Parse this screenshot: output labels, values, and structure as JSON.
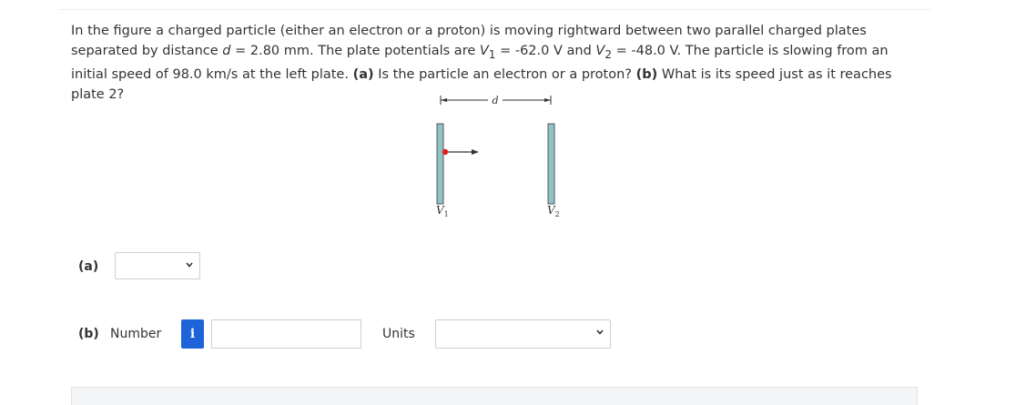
{
  "question": {
    "s1": "In the figure a charged particle (either an electron or a proton) is moving rightward between two parallel charged plates separated by distance ",
    "d_var": "d",
    "s2": " = 2.80 mm. The plate potentials are ",
    "v1_var": "V",
    "v1_sub": "1",
    "s3": " = -62.0 V and ",
    "v2_var": "V",
    "v2_sub": "2",
    "s4": " = -48.0 V. The particle is slowing from an initial speed of 98.0 km/s at the left plate. ",
    "part_a_label": "(a)",
    "part_a_text": " Is the particle an electron or a proton? ",
    "part_b_label": "(b)",
    "part_b_text": " What is its speed just as it reaches plate 2?"
  },
  "figure": {
    "d_label": "d",
    "plate1_var": "V",
    "plate1_sub": "1",
    "plate2_var": "V",
    "plate2_sub": "2",
    "plate_color": "#8fc3c4",
    "particle_color": "#e02020"
  },
  "answer_a": {
    "label": "(a)",
    "selected": ""
  },
  "answer_b": {
    "label": "(b)",
    "number_label": "Number",
    "info_glyph": "i",
    "number_value": "",
    "units_label": "Units",
    "units_selected": ""
  },
  "colors": {
    "accent": "#1e64d8",
    "border": "#cfcfcf"
  }
}
